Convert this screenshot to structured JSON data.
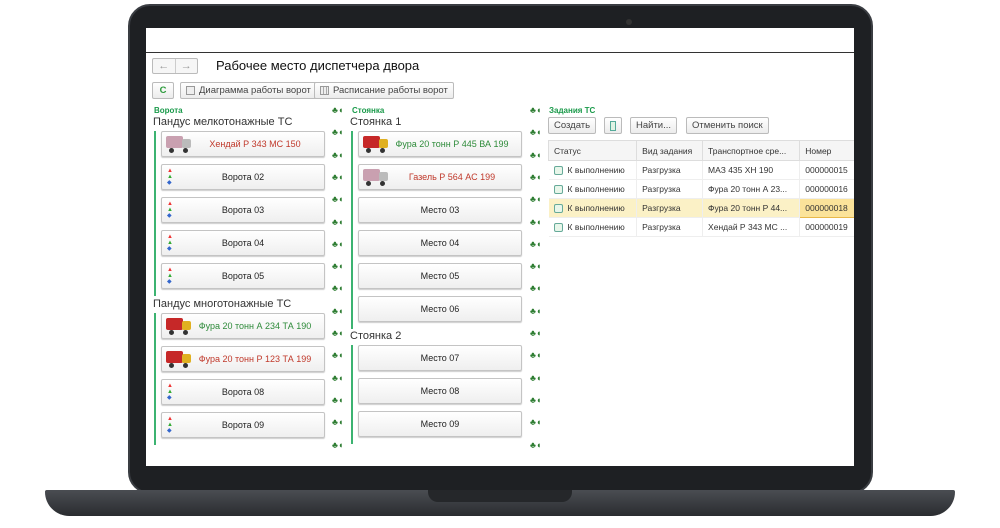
{
  "window": {
    "title": "Рабочее место диспетчера двора",
    "nav_back": "←",
    "nav_forward": "→"
  },
  "toolbar": {
    "refresh": "C",
    "gate_chart": "Диаграмма работы ворот",
    "gate_schedule": "Расписание работы ворот"
  },
  "gates": {
    "label": "Ворота",
    "groups": [
      {
        "title": "Пандус мелкотонажные ТС",
        "items": [
          {
            "label": "Хендай Р 343 МС 150",
            "kind": "van",
            "color": "#c0392b"
          },
          {
            "label": "Ворота 02",
            "kind": "empty"
          },
          {
            "label": "Ворота 03",
            "kind": "empty"
          },
          {
            "label": "Ворота 04",
            "kind": "empty"
          },
          {
            "label": "Ворота 05",
            "kind": "empty"
          }
        ]
      },
      {
        "title": "Пандус многотонажные ТС",
        "items": [
          {
            "label": "Фура 20 тонн А 234 ТА 190",
            "kind": "truck",
            "color": "#2e8b3a"
          },
          {
            "label": "Фура 20 тонн  Р 123 ТА 199",
            "kind": "truck",
            "color": "#c0392b"
          },
          {
            "label": "Ворота 08",
            "kind": "empty"
          },
          {
            "label": "Ворота 09",
            "kind": "empty"
          }
        ]
      }
    ]
  },
  "parking": {
    "label": "Стоянка",
    "groups": [
      {
        "title": "Стоянка 1",
        "items": [
          {
            "label": "Фура 20 тонн Р 445 ВА 199",
            "kind": "truck",
            "color": "#2e8b3a"
          },
          {
            "label": "Газель Р 564 АС 199",
            "kind": "van",
            "color": "#c0392b"
          },
          {
            "label": "Место 03",
            "kind": "plain"
          },
          {
            "label": "Место 04",
            "kind": "plain"
          },
          {
            "label": "Место 05",
            "kind": "plain"
          },
          {
            "label": "Место 06",
            "kind": "plain"
          }
        ]
      },
      {
        "title": "Стоянка 2",
        "items": [
          {
            "label": "Место 07",
            "kind": "plain"
          },
          {
            "label": "Место 08",
            "kind": "plain"
          },
          {
            "label": "Место 09",
            "kind": "plain"
          }
        ]
      }
    ]
  },
  "tasks": {
    "label": "Задания ТС",
    "create": "Создать",
    "find": "Найти...",
    "cancel_search": "Отменить поиск",
    "columns": [
      "Статус",
      "Вид задания",
      "Транспортное сре...",
      "Номер"
    ],
    "rows": [
      {
        "status": "К выполнению",
        "type": "Разгрузка",
        "vehicle": "МАЗ 435 ХН 190",
        "number": "000000015"
      },
      {
        "status": "К выполнению",
        "type": "Разгрузка",
        "vehicle": "Фура 20 тонн А 23...",
        "number": "000000016"
      },
      {
        "status": "К выполнению",
        "type": "Разгрузка",
        "vehicle": "Фура 20 тонн Р 44...",
        "number": "000000018",
        "selected": true
      },
      {
        "status": "К выполнению",
        "type": "Разгрузка",
        "vehicle": "Хендай Р 343 МС ...",
        "number": "000000019"
      }
    ]
  }
}
